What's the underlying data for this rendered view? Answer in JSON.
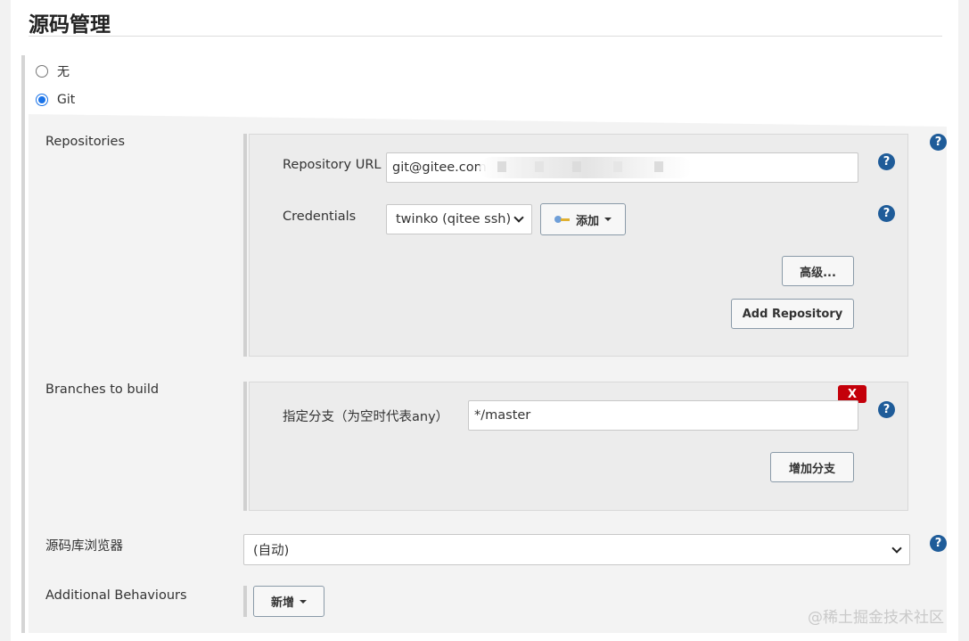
{
  "section": {
    "title": "源码管理"
  },
  "scm_options": [
    {
      "label": "无",
      "selected": false
    },
    {
      "label": "Git",
      "selected": true
    }
  ],
  "repositories": {
    "label": "Repositories",
    "url_label": "Repository URL",
    "url_value": "git@gitee.com",
    "credentials_label": "Credentials",
    "credentials_value": "twinko (qitee ssh)",
    "add_button": "添加",
    "advanced_button": "高级...",
    "add_repository_button": "Add Repository"
  },
  "branches": {
    "label": "Branches to build",
    "branch_label": "指定分支（为空时代表any）",
    "branch_value": "*/master",
    "delete_button": "X",
    "add_branch_button": "增加分支"
  },
  "repo_browser": {
    "label": "源码库浏览器",
    "value": "(自动)"
  },
  "additional": {
    "label": "Additional Behaviours",
    "add_button": "新增"
  },
  "help_icon_glyph": "?",
  "watermark": "@稀土掘金技术社区",
  "colors": {
    "help": "#1f5c99",
    "delete": "#c4000a",
    "radio_selected": "#1a73e8"
  }
}
